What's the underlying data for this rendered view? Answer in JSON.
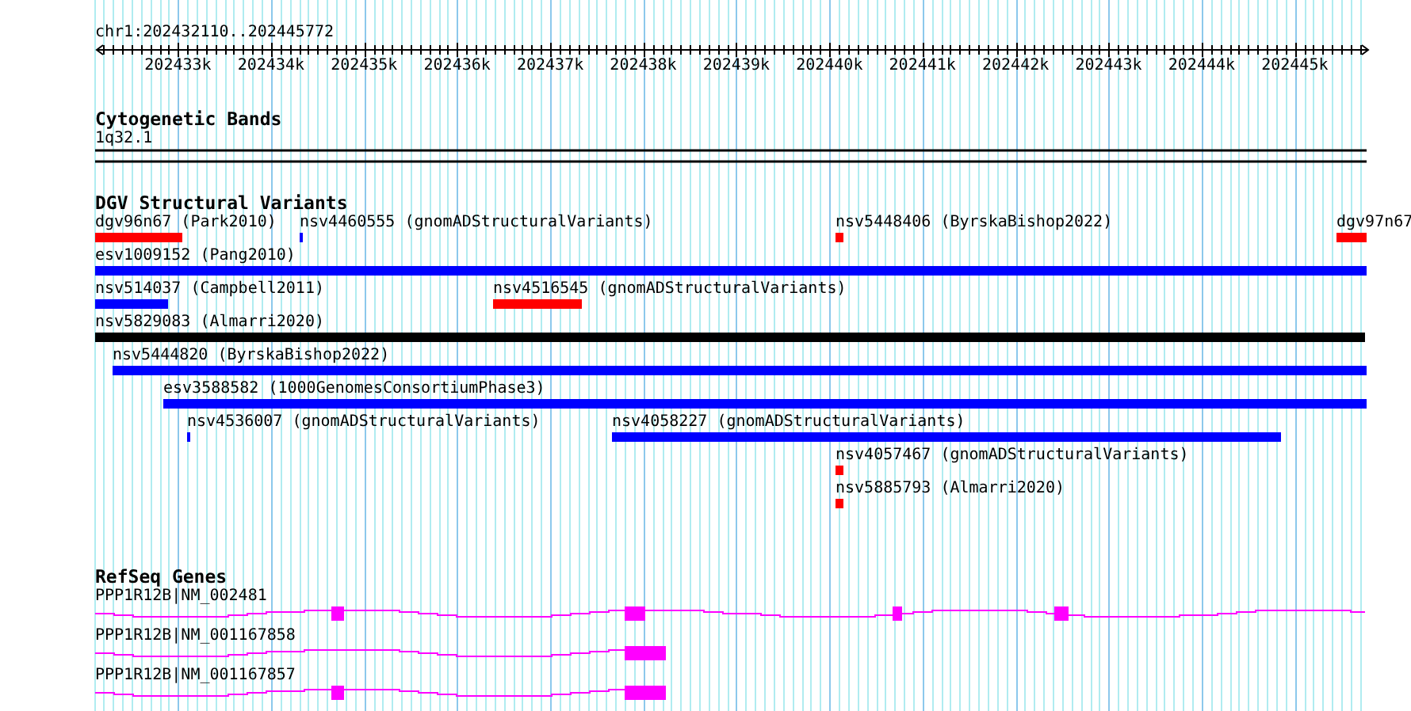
{
  "ruler": {
    "locus": "chr1:202432110..202445772",
    "ticks": [
      "202433k",
      "202434k",
      "202435k",
      "202436k",
      "202437k",
      "202438k",
      "202439k",
      "202440k",
      "202441k",
      "202442k",
      "202443k",
      "202444k",
      "202445k"
    ]
  },
  "cytoband": {
    "title": "Cytogenetic Bands",
    "band": "1q32.1"
  },
  "dgv": {
    "title": "DGV Structural Variants",
    "rows": [
      [
        {
          "label": "dgv96n67 (Park2010)",
          "color": "#ff0000"
        },
        {
          "label": "nsv4460555 (gnomADStructuralVariants)",
          "color": "#0000ff"
        },
        {
          "label": "nsv5448406 (ByrskaBishop2022)",
          "color": "#ff0000"
        },
        {
          "label": "dgv97n67",
          "color": "#ff0000"
        }
      ],
      [
        {
          "label": "esv1009152 (Pang2010)",
          "color": "#0000ff"
        }
      ],
      [
        {
          "label": "nsv514037 (Campbell2011)",
          "color": "#0000ff"
        },
        {
          "label": "nsv4516545 (gnomADStructuralVariants)",
          "color": "#ff0000"
        }
      ],
      [
        {
          "label": "nsv5829083 (Almarri2020)",
          "color": "#000000"
        }
      ],
      [
        {
          "label": "nsv5444820 (ByrskaBishop2022)",
          "color": "#0000ff"
        }
      ],
      [
        {
          "label": "esv3588582 (1000GenomesConsortiumPhase3)",
          "color": "#0000ff"
        }
      ],
      [
        {
          "label": "nsv4536007 (gnomADStructuralVariants)",
          "color": "#0000ff"
        },
        {
          "label": "nsv4058227 (gnomADStructuralVariants)",
          "color": "#0000ff"
        }
      ],
      [
        {
          "label": "nsv4057467 (gnomADStructuralVariants)",
          "color": "#ff0000"
        }
      ],
      [
        {
          "label": "nsv5885793 (Almarri2020)",
          "color": "#ff0000"
        }
      ]
    ]
  },
  "genes": {
    "title": "RefSeq Genes",
    "transcripts": [
      {
        "label": "PPP1R12B|NM_002481"
      },
      {
        "label": "PPP1R12B|NM_001167858"
      },
      {
        "label": "PPP1R12B|NM_001167857"
      }
    ]
  }
}
